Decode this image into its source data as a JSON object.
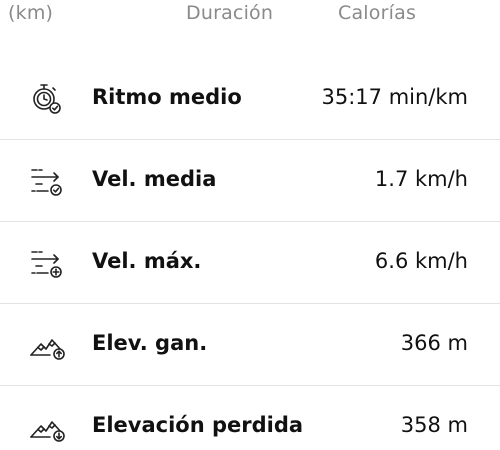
{
  "header": {
    "distance_label": "(km)",
    "duration_label": "Duración",
    "calories_label": "Calorías"
  },
  "stats": [
    {
      "icon": "stopwatch-icon",
      "label": "Ritmo medio",
      "value": "35:17 min/km"
    },
    {
      "icon": "speed-avg-icon",
      "label": "Vel. media",
      "value": "1.7 km/h"
    },
    {
      "icon": "speed-max-icon",
      "label": "Vel. máx.",
      "value": "6.6 km/h"
    },
    {
      "icon": "elevation-gain-icon",
      "label": "Elev. gan.",
      "value": "366 m"
    },
    {
      "icon": "elevation-loss-icon",
      "label": "Elevación perdida",
      "value": "358 m"
    }
  ]
}
